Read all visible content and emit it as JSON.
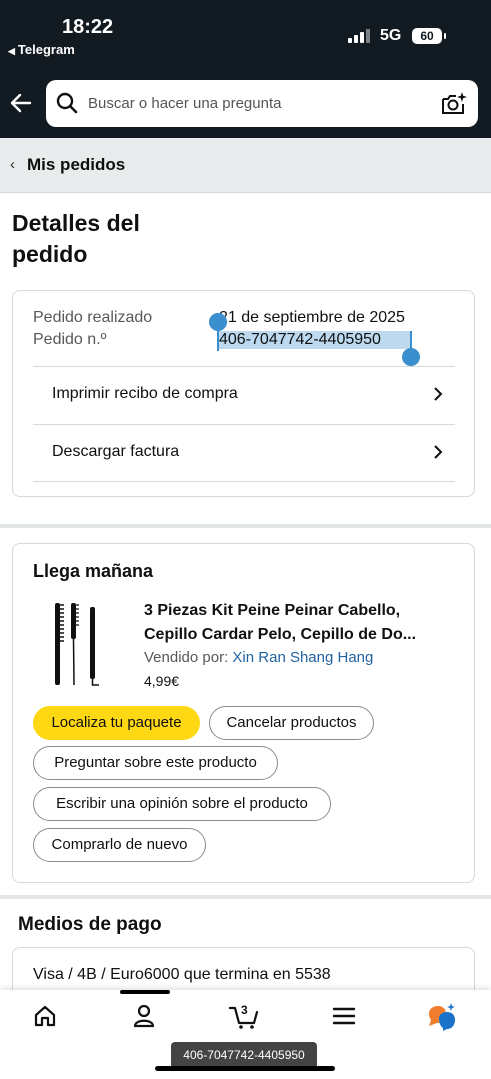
{
  "status_bar": {
    "time": "18:22",
    "back_app": "Telegram",
    "network": "5G",
    "battery": "60"
  },
  "header": {
    "search_placeholder": "Buscar o hacer una pregunta"
  },
  "breadcrumb": {
    "label": "Mis pedidos"
  },
  "page_title": "Detalles del pedido",
  "order": {
    "placed_label": "Pedido realizado",
    "placed_value": "21 de septiembre de 2025",
    "number_label": "Pedido n.º",
    "number_value": "406-7047742-4405950",
    "actions": [
      "Imprimir recibo de compra",
      "Descargar factura"
    ]
  },
  "shipment": {
    "title": "Llega mañana",
    "product_line1": "3 Piezas Kit Peine Peinar Cabello,",
    "product_line2": "Cepillo Cardar Pelo, Cepillo de Do...",
    "seller_label": "Vendido por:",
    "seller_name": "Xin Ran Shang Hang",
    "price": "4,99€",
    "buttons": {
      "track": "Localiza tu paquete",
      "cancel": "Cancelar productos",
      "ask": "Preguntar sobre este producto",
      "review": "Escribir una opinión sobre el producto",
      "rebuy": "Comprarlo de nuevo"
    }
  },
  "payment": {
    "title": "Medios de pago",
    "method": "Visa / 4B / Euro6000  que termina en 5538"
  },
  "bottom_nav": {
    "cart_count": "3"
  },
  "toast": "406-7047742-4405950",
  "colors": {
    "header_bg": "#121a22",
    "primary_button": "#ffd814",
    "link": "#2162a1",
    "selection": "#bcd9ef",
    "handle": "#3b8fcf"
  },
  "icons": [
    "arrow-left-icon",
    "search-icon",
    "camera-search-icon",
    "chevron-left-icon",
    "chevron-right-icon",
    "home-icon",
    "account-icon",
    "cart-icon",
    "menu-icon",
    "rufus-assistant-icon"
  ]
}
